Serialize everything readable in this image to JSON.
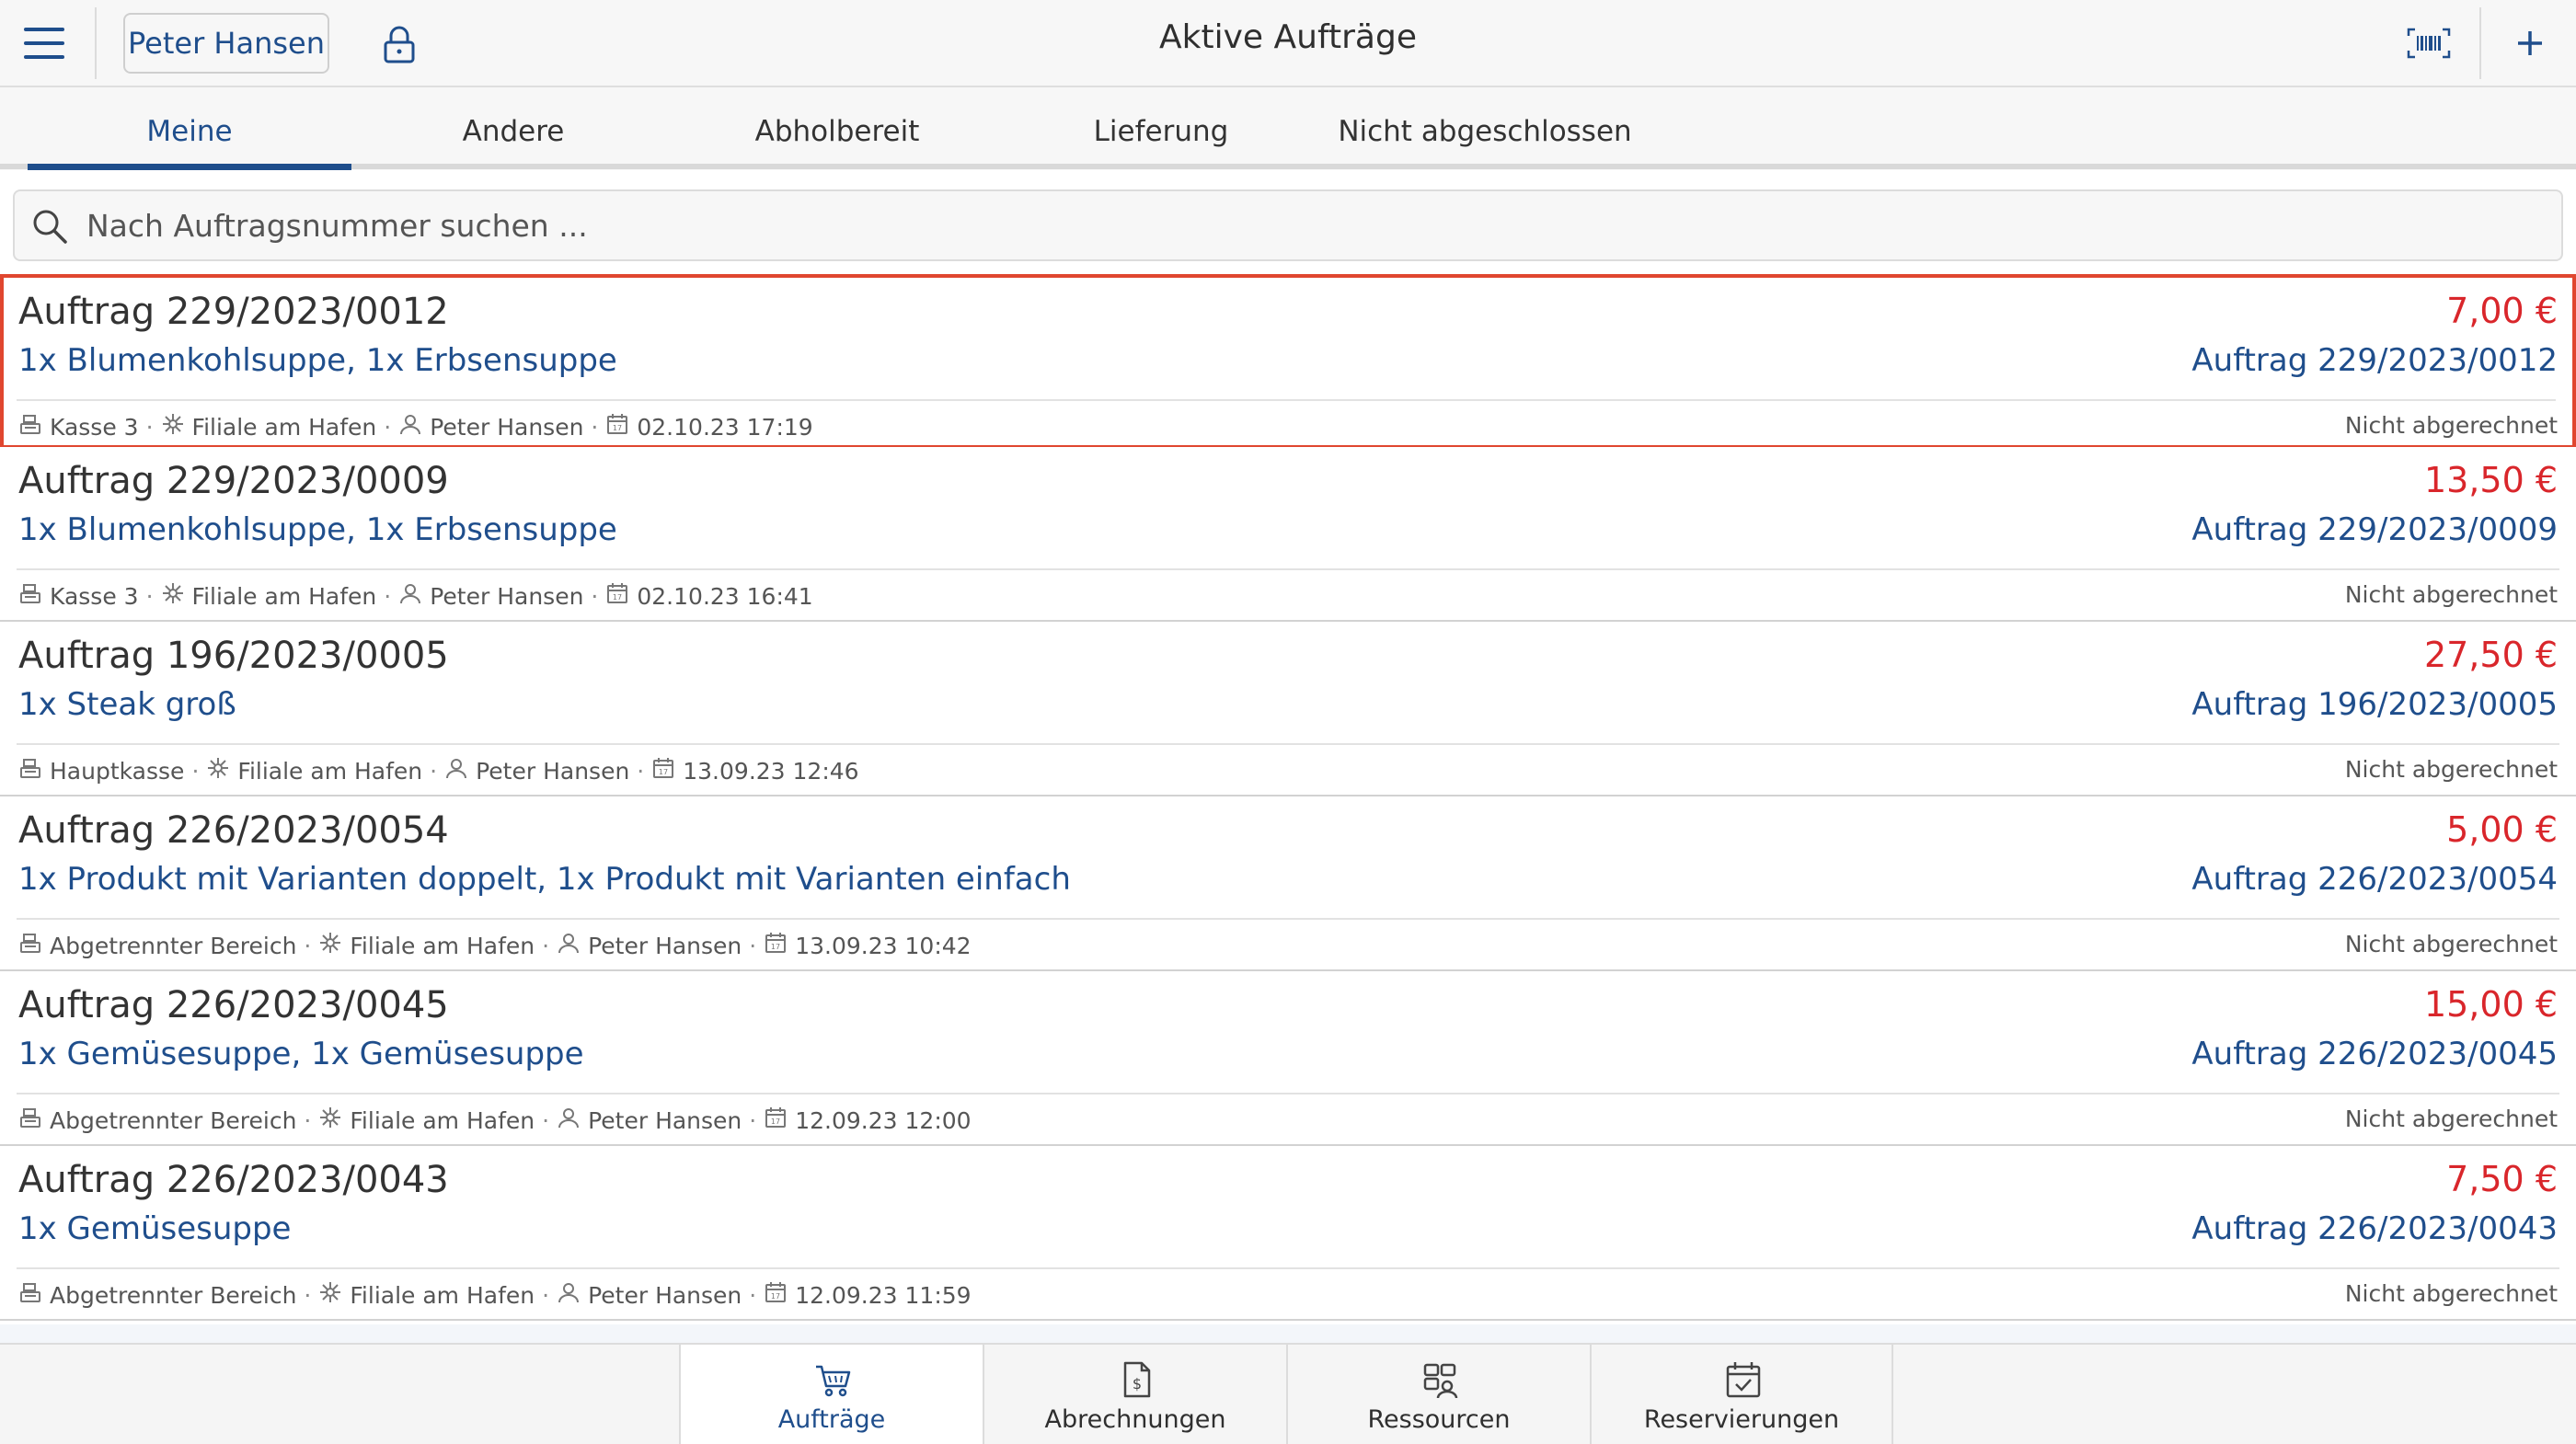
{
  "header": {
    "user_label": "Peter Hansen",
    "title": "Aktive Aufträge",
    "icons": [
      "menu-icon",
      "lock-icon",
      "barcode-icon",
      "plus-icon"
    ]
  },
  "tabs": [
    {
      "label": "Meine",
      "active": true
    },
    {
      "label": "Andere",
      "active": false
    },
    {
      "label": "Abholbereit",
      "active": false
    },
    {
      "label": "Lieferung",
      "active": false
    },
    {
      "label": "Nicht abgeschlossen",
      "active": false
    }
  ],
  "search": {
    "placeholder": "Nach Auftragsnummer suchen ..."
  },
  "colors": {
    "accent": "#1f4e8c",
    "price": "#d9262b",
    "selection": "#e0462f"
  },
  "orders": [
    {
      "title": "Auftrag 229/2023/0012",
      "items": "1x Blumenkohlsuppe, 1x Erbsensuppe",
      "price": "7,00 €",
      "ref": "Auftrag 229/2023/0012",
      "register": "Kasse 3",
      "branch": "Filiale am Hafen",
      "user": "Peter Hansen",
      "date": "02.10.23 17:19",
      "status": "Nicht abgerechnet",
      "selected": true
    },
    {
      "title": "Auftrag 229/2023/0009",
      "items": "1x Blumenkohlsuppe, 1x Erbsensuppe",
      "price": "13,50 €",
      "ref": "Auftrag 229/2023/0009",
      "register": "Kasse 3",
      "branch": "Filiale am Hafen",
      "user": "Peter Hansen",
      "date": "02.10.23 16:41",
      "status": "Nicht abgerechnet",
      "selected": false
    },
    {
      "title": "Auftrag 196/2023/0005",
      "items": "1x Steak groß",
      "price": "27,50 €",
      "ref": "Auftrag 196/2023/0005",
      "register": "Hauptkasse",
      "branch": "Filiale am Hafen",
      "user": "Peter Hansen",
      "date": "13.09.23 12:46",
      "status": "Nicht abgerechnet",
      "selected": false
    },
    {
      "title": "Auftrag 226/2023/0054",
      "items": "1x Produkt mit Varianten doppelt, 1x Produkt mit Varianten einfach",
      "price": "5,00 €",
      "ref": "Auftrag 226/2023/0054",
      "register": "Abgetrennter Bereich",
      "branch": "Filiale am Hafen",
      "user": "Peter Hansen",
      "date": "13.09.23 10:42",
      "status": "Nicht abgerechnet",
      "selected": false
    },
    {
      "title": "Auftrag 226/2023/0045",
      "items": "1x Gemüsesuppe, 1x Gemüsesuppe",
      "price": "15,00 €",
      "ref": "Auftrag 226/2023/0045",
      "register": "Abgetrennter Bereich",
      "branch": "Filiale am Hafen",
      "user": "Peter Hansen",
      "date": "12.09.23 12:00",
      "status": "Nicht abgerechnet",
      "selected": false
    },
    {
      "title": "Auftrag 226/2023/0043",
      "items": "1x Gemüsesuppe",
      "price": "7,50 €",
      "ref": "Auftrag 226/2023/0043",
      "register": "Abgetrennter Bereich",
      "branch": "Filiale am Hafen",
      "user": "Peter Hansen",
      "date": "12.09.23 11:59",
      "status": "Nicht abgerechnet",
      "selected": false
    }
  ],
  "bottom_nav": [
    {
      "label": "Aufträge",
      "icon": "cart-icon",
      "active": true
    },
    {
      "label": "Abrechnungen",
      "icon": "invoice-icon",
      "active": false
    },
    {
      "label": "Ressourcen",
      "icon": "resources-icon",
      "active": false
    },
    {
      "label": "Reservierungen",
      "icon": "calendar-check-icon",
      "active": false
    }
  ]
}
